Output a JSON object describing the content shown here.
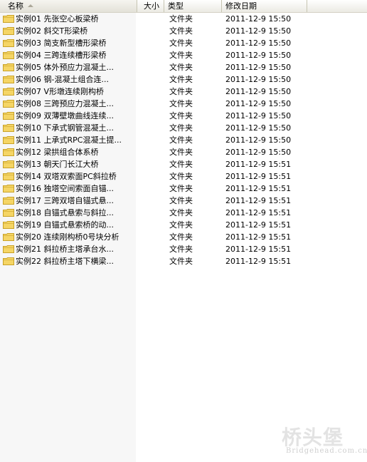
{
  "header": {
    "name": "名称",
    "size": "大小",
    "type": "类型",
    "modified": "修改日期"
  },
  "rows": [
    {
      "name": "实例01 先张空心板梁桥",
      "type": "文件夹",
      "date": "2011-12-9 15:50"
    },
    {
      "name": "实例02 斜交T形梁桥",
      "type": "文件夹",
      "date": "2011-12-9 15:50"
    },
    {
      "name": "实例03 简支新型槽形梁桥",
      "type": "文件夹",
      "date": "2011-12-9 15:50"
    },
    {
      "name": "实例04 三跨连续槽形梁桥",
      "type": "文件夹",
      "date": "2011-12-9 15:50"
    },
    {
      "name": "实例05 体外预应力混凝土...",
      "type": "文件夹",
      "date": "2011-12-9 15:50"
    },
    {
      "name": "实例06 钢-混凝土组合连...",
      "type": "文件夹",
      "date": "2011-12-9 15:50"
    },
    {
      "name": "实例07 V形墩连续刚构桥",
      "type": "文件夹",
      "date": "2011-12-9 15:50"
    },
    {
      "name": "实例08 三跨预应力混凝土...",
      "type": "文件夹",
      "date": "2011-12-9 15:50"
    },
    {
      "name": "实例09 双薄壁墩曲线连续...",
      "type": "文件夹",
      "date": "2011-12-9 15:50"
    },
    {
      "name": "实例10 下承式钢管混凝土...",
      "type": "文件夹",
      "date": "2011-12-9 15:50"
    },
    {
      "name": "实例11 上承式RPC混凝土提...",
      "type": "文件夹",
      "date": "2011-12-9 15:50"
    },
    {
      "name": "实例12 梁拱组合体系桥",
      "type": "文件夹",
      "date": "2011-12-9 15:50"
    },
    {
      "name": "实例13 朝天门长江大桥",
      "type": "文件夹",
      "date": "2011-12-9 15:51"
    },
    {
      "name": "实例14 双塔双索面PC斜拉桥",
      "type": "文件夹",
      "date": "2011-12-9 15:51"
    },
    {
      "name": "实例16 独塔空间索面自锚...",
      "type": "文件夹",
      "date": "2011-12-9 15:51"
    },
    {
      "name": "实例17 三跨双塔自锚式悬...",
      "type": "文件夹",
      "date": "2011-12-9 15:51"
    },
    {
      "name": "实例18 自锚式悬索与斜拉...",
      "type": "文件夹",
      "date": "2011-12-9 15:51"
    },
    {
      "name": "实例19 自锚式悬索桥的动...",
      "type": "文件夹",
      "date": "2011-12-9 15:51"
    },
    {
      "name": "实例20 连续刚构桥0号块分析",
      "type": "文件夹",
      "date": "2011-12-9 15:51"
    },
    {
      "name": "实例21 斜拉桥主塔承台水...",
      "type": "文件夹",
      "date": "2011-12-9 15:51"
    },
    {
      "name": "实例22 斜拉桥主塔下横梁...",
      "type": "文件夹",
      "date": "2011-12-9 15:51"
    }
  ],
  "watermark": {
    "main": "桥头堡",
    "sub": "Bridgehead.com.cn"
  },
  "colors": {
    "folder": "#f5d565",
    "folder_dark": "#c9a227",
    "name_column_bg": "#f7f7f7"
  }
}
